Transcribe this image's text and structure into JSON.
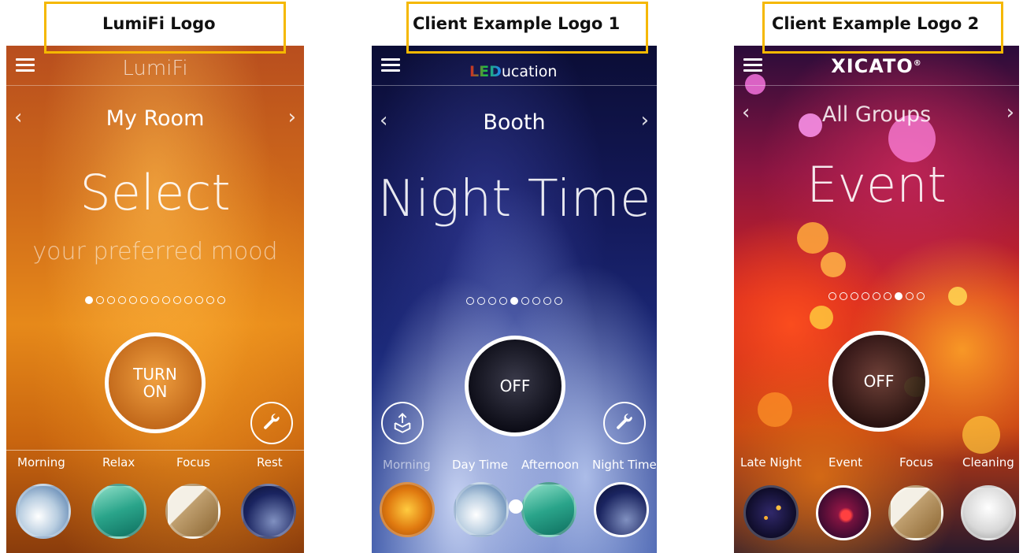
{
  "captions": [
    {
      "text": "LumiFi Logo"
    },
    {
      "text": "Client Example Logo 1"
    },
    {
      "text": "Client Example Logo 2"
    }
  ],
  "panels": [
    {
      "logo": "LumiFi",
      "room": "My Room",
      "headline": "Select",
      "subline": "your preferred mood",
      "dots_total": 13,
      "dots_active": 0,
      "power_label_line1": "TURN",
      "power_label_line2": "ON",
      "scenes": [
        "Morning",
        "Relax",
        "Focus",
        "Rest"
      ]
    },
    {
      "logo_colored": "LED",
      "logo_rest": "ucation",
      "room": "Booth",
      "headline": "Night Time",
      "dots_total": 9,
      "dots_active": 4,
      "power_label": "OFF",
      "scenes": [
        "Morning",
        "Day Time",
        "Afternoon",
        "Night Time"
      ]
    },
    {
      "logo": "XICATO",
      "logo_mark": "®",
      "room": "All Groups",
      "headline": "Event",
      "dots_total": 9,
      "dots_active": 6,
      "power_label": "OFF",
      "scenes": [
        "Late Night",
        "Event",
        "Focus",
        "Cleaning"
      ]
    }
  ],
  "icons": [
    "menu-icon",
    "chevron-left-icon",
    "chevron-right-icon",
    "wrench-icon",
    "share-box-icon"
  ],
  "colors": {
    "caption_border": "#f5b800",
    "lumifi_bg": "#d9761a",
    "education_bg": "#141a5c",
    "xicato_bg": "#c5261f"
  }
}
